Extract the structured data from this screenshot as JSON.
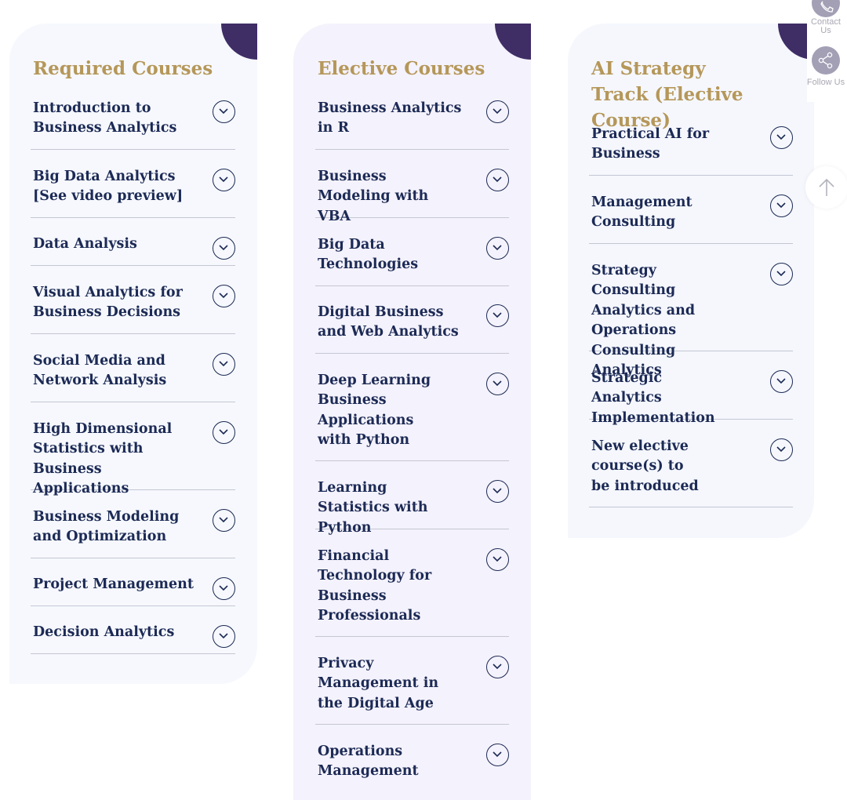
{
  "required": {
    "title": "Required Courses",
    "courses": [
      "Introduction to Business Analytics",
      "Big Data Analytics [See video preview]",
      "Data Analysis",
      "Visual Analytics for Business Decisions",
      "Social Media and Network Analysis",
      "High Dimensional Statistics with Business Applications",
      "Business Modeling and Optimization",
      "Project Management",
      "Decision Analytics"
    ]
  },
  "elective": {
    "title": "Elective Courses",
    "courses": [
      "Business Analytics in R",
      "Business Modeling with VBA",
      "Big Data Technologies",
      "Digital Business and Web Analytics",
      "Deep Learning Business Applications with Python",
      "Learning Statistics with Python",
      "Financial Technology for Business Professionals",
      "Privacy Management in the Digital Age",
      "Operations Management"
    ]
  },
  "ai_track": {
    "title": "AI Strategy Track (Elective Course)",
    "courses": [
      "Practical AI for Business",
      "Management Consulting",
      "Strategy Consulting Analytics and Operations Consulting Analytics",
      "Strategic Analytics Implementation",
      "New elective course(s) to be introduced"
    ]
  },
  "floating": {
    "contact_label": "Contact Us",
    "follow_label": "Follow Us"
  },
  "colors": {
    "title_gold": "#b59759",
    "text_navy": "#1c2a55",
    "corner_purple": "#3f2d66",
    "divider": "#c4c7d3"
  },
  "icons": {
    "toggle": "chevron-down-icon",
    "contact": "phone-icon",
    "follow": "share-icon",
    "scroll": "arrow-up-icon"
  }
}
